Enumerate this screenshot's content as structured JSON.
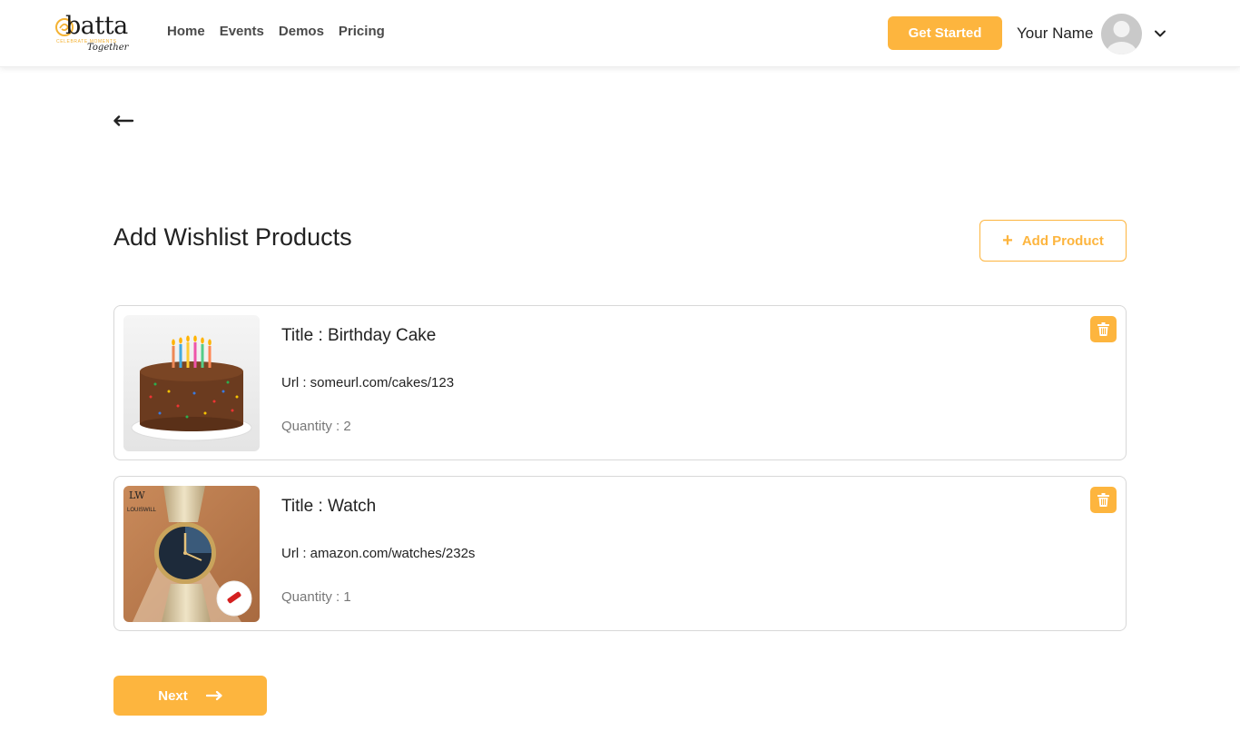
{
  "brand": {
    "name": "batta",
    "tagline": "CELEBRATE MOMENTS",
    "script": "Together",
    "accent_color": "#fdb53e"
  },
  "nav": {
    "links": [
      "Home",
      "Events",
      "Demos",
      "Pricing"
    ],
    "get_started_label": "Get Started",
    "user_name": "Your Name"
  },
  "page": {
    "title": "Add Wishlist Products",
    "add_product_label": "Add Product",
    "next_label": "Next"
  },
  "products": [
    {
      "title": "Title : Birthday Cake",
      "url": "Url : someurl.com/cakes/123",
      "quantity": "Quantity : 2",
      "image_icon": "birthday-cake-image"
    },
    {
      "title": "Title : Watch",
      "url": "Url : amazon.com/watches/232s",
      "quantity": "Quantity : 1",
      "image_icon": "watch-image",
      "image_brand": "LOUISWILL"
    }
  ]
}
